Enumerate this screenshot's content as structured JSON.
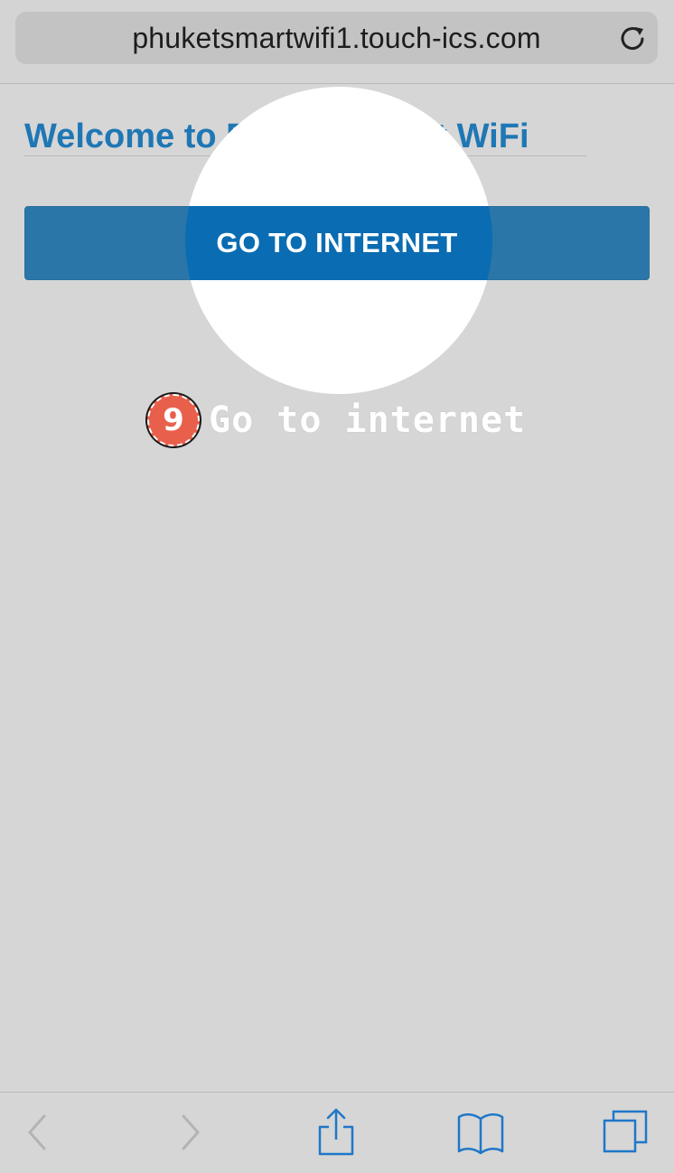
{
  "browser": {
    "url": "phuketsmartwifi1.touch-ics.com",
    "reload_icon": "reload-icon"
  },
  "page": {
    "heading": "Welcome to Phuket Smart WiFi",
    "button_label": "GO TO INTERNET",
    "accent_color": "#1f77b4",
    "button_color": "#2b76a8"
  },
  "annotation": {
    "step_number": "9",
    "step_text": "Go to internet",
    "badge_color": "#e8604c"
  },
  "toolbar": {
    "items": [
      {
        "icon": "back-icon",
        "enabled": false
      },
      {
        "icon": "forward-icon",
        "enabled": false
      },
      {
        "icon": "share-icon",
        "enabled": true
      },
      {
        "icon": "bookmarks-icon",
        "enabled": true
      },
      {
        "icon": "tabs-icon",
        "enabled": true
      }
    ]
  }
}
